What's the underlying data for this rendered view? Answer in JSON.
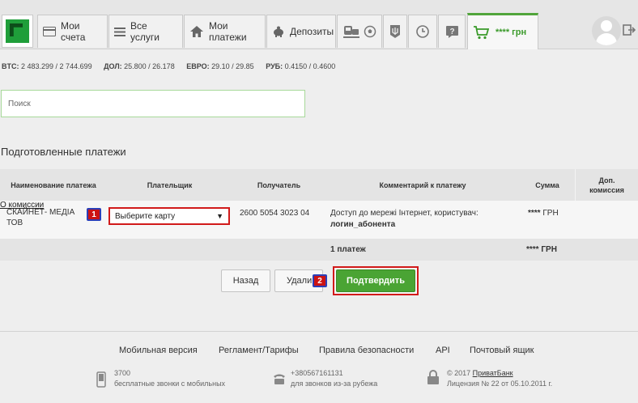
{
  "nav": {
    "tabs": [
      {
        "label": "Мои счета",
        "icon": "card-icon"
      },
      {
        "label": "Все услуги",
        "icon": "list-icon"
      },
      {
        "label": "Мои платежи",
        "icon": "house-icon"
      },
      {
        "label": "Депозиты",
        "icon": "piggy-bank-icon"
      }
    ],
    "balance": "**** грн"
  },
  "rates": {
    "btc_label": "BTC:",
    "btc_value": "2 483.299 / 2 744.699",
    "usd_label": "ДОЛ:",
    "usd_value": "25.800 / 26.178",
    "eur_label": "ЕВРО:",
    "eur_value": "29.10 / 29.85",
    "rub_label": "РУБ:",
    "rub_value": "0.4150 / 0.4600"
  },
  "search": {
    "placeholder": "Поиск"
  },
  "section_title": "Подготовленные платежи",
  "table": {
    "headers": {
      "name": "Наименование платежа",
      "payer": "Плательщик",
      "recipient": "Получатель",
      "comment": "Комментарий к платежу",
      "sum": "Сумма",
      "commission_line1": "Доп.",
      "commission_line2": "комиссия"
    },
    "row": {
      "name_line1": "СКАЙНЕТ- МЕДІА",
      "name_line2": "ТОВ",
      "payer_select": "Выберите карту",
      "recipient": "2600 5054 3023 04",
      "comment_line1": "Доступ до мережі Інтернет, користувач:",
      "comment_line2": "логин_абонента",
      "sum_stars": "****",
      "sum_currency": "ГРН",
      "commission_link": "О комиссии"
    },
    "footer": {
      "count": "1 платеж",
      "sum_stars": "****",
      "sum_currency": "ГРН"
    }
  },
  "badges": {
    "one": "1",
    "two": "2"
  },
  "buttons": {
    "back": "Назад",
    "delete": "Удали",
    "confirm": "Подтвердить"
  },
  "footer": {
    "links": [
      "Мобильная версия",
      "Регламент/Тарифы",
      "Правила безопасности",
      "API",
      "Почтовый ящик"
    ],
    "phone_short": "3700",
    "phone_short_desc": "бесплатные звонки с мобильных",
    "phone_full": "+380567161131",
    "phone_full_desc": "для звонков из-за рубежа",
    "copyright_prefix": "© 2017",
    "bank_name": "ПриватБанк",
    "license": "Лицензия № 22 от 05.10.2011 г."
  }
}
